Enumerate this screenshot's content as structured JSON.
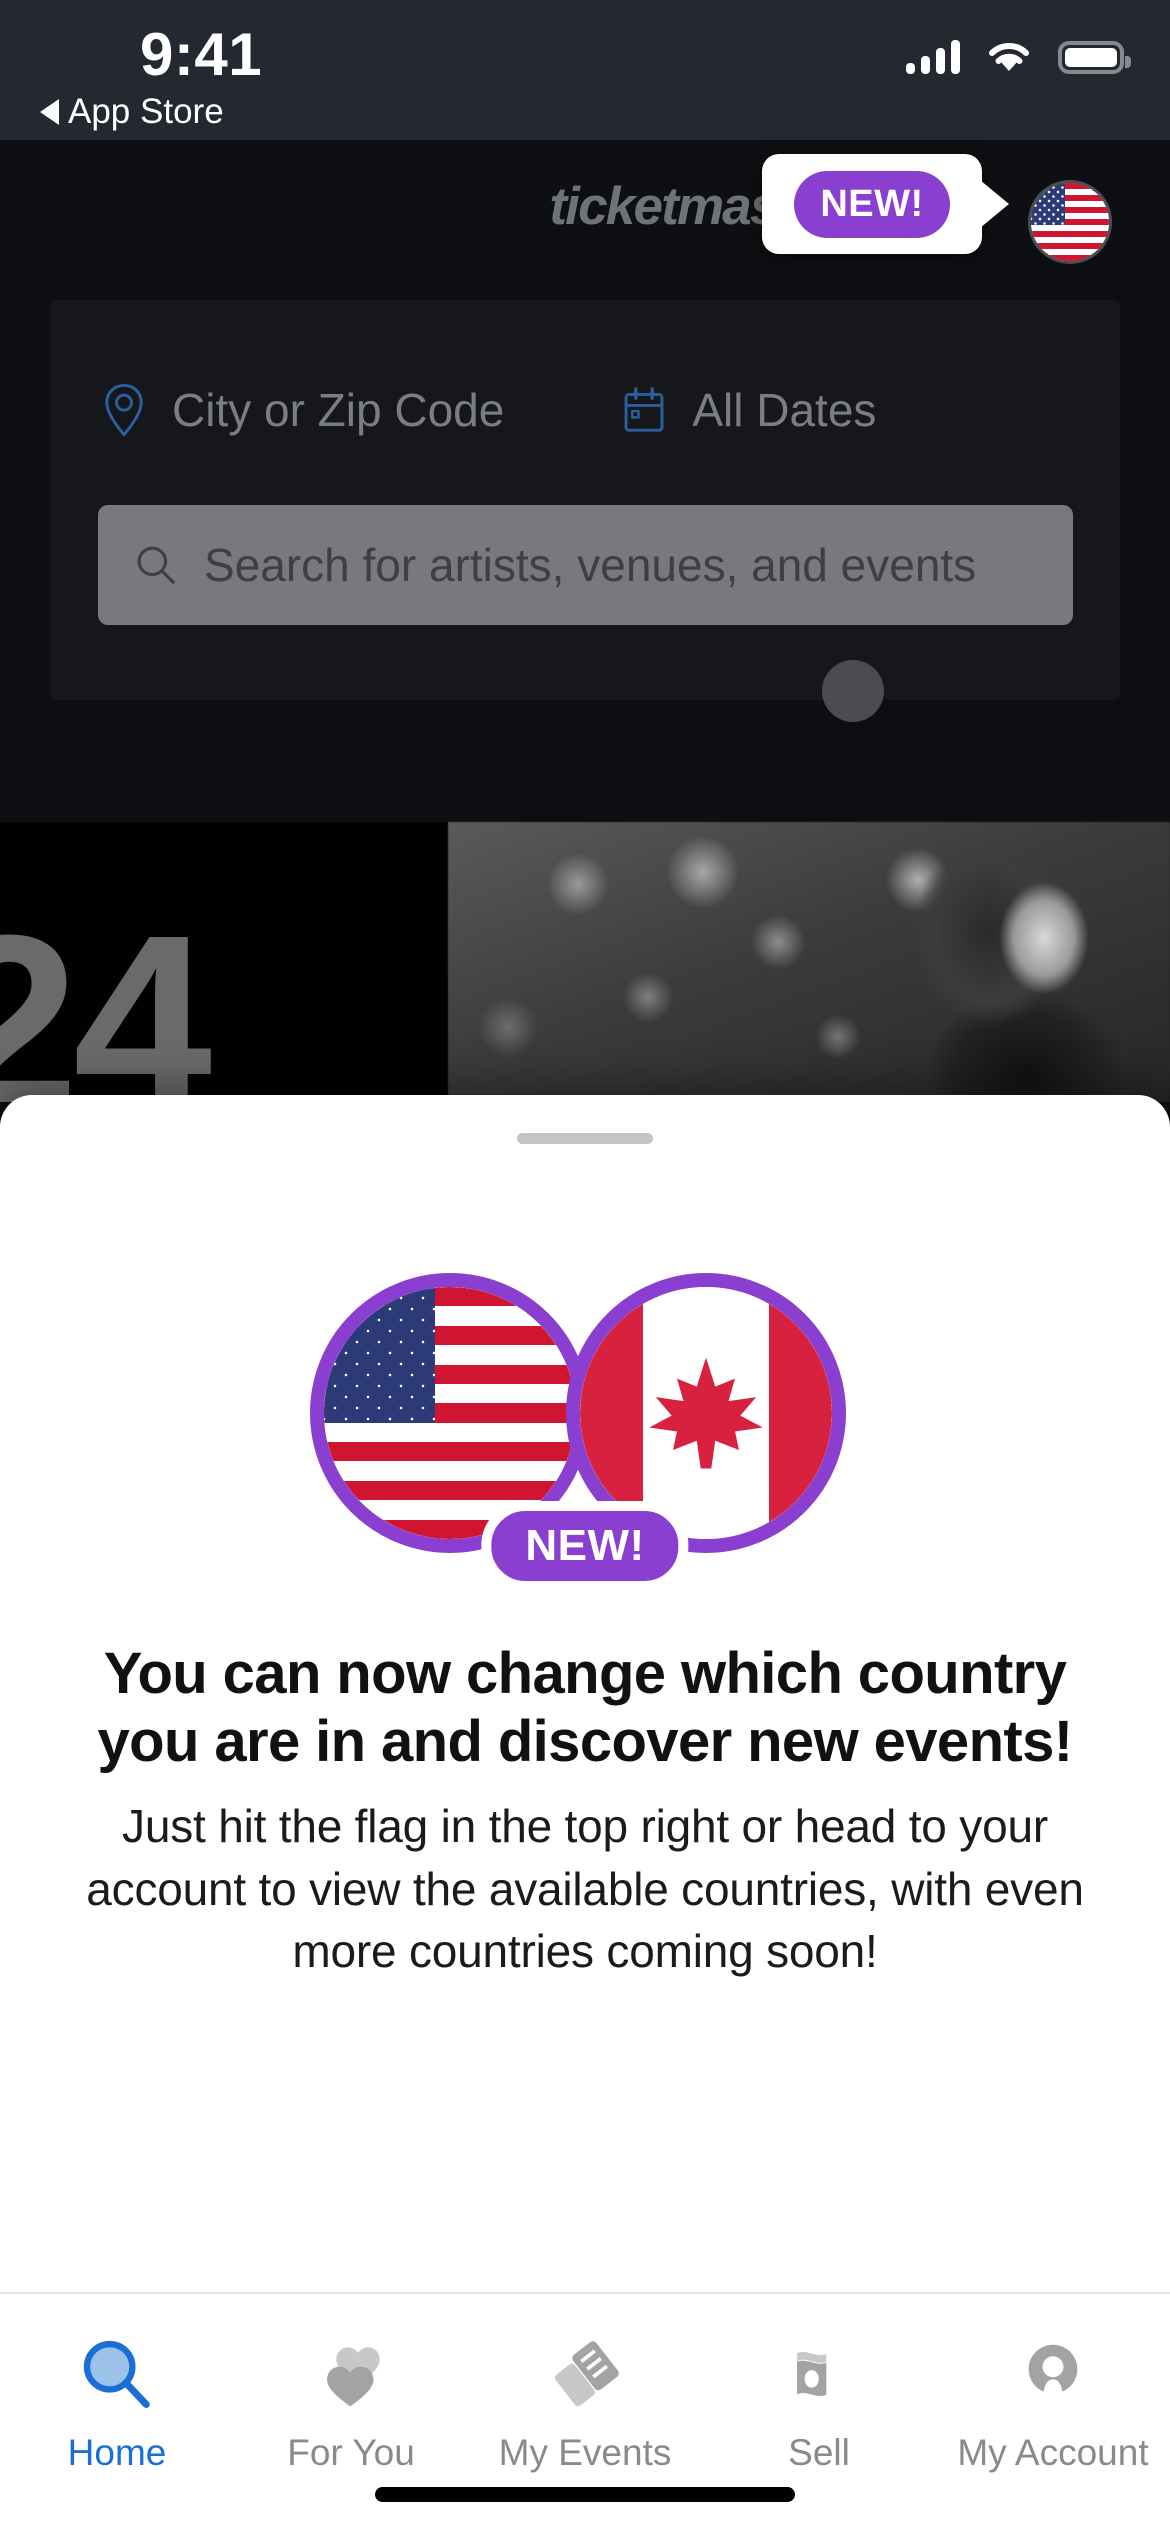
{
  "status_bar": {
    "time": "9:41",
    "back_label": "App Store",
    "signal_icon": "cellular-signal-icon",
    "wifi_icon": "wifi-icon",
    "battery_icon": "battery-icon"
  },
  "header": {
    "logo_text": "ticketmaster",
    "tooltip_badge": "NEW!",
    "country_flag_icon": "us-flag-icon"
  },
  "search_panel": {
    "location_placeholder": "City or Zip Code",
    "location_icon": "map-pin-icon",
    "date_value": "All Dates",
    "date_icon": "calendar-icon",
    "search_placeholder": "Search for artists, venues, and events",
    "search_icon": "search-icon"
  },
  "hero": {
    "left_text": "24",
    "image_alt": "concert-singer-photo"
  },
  "sheet": {
    "grabber": "drag-handle",
    "illustration": {
      "us_flag_icon": "us-flag-circle-icon",
      "canada_flag_icon": "canada-flag-circle-icon",
      "badge": "NEW!"
    },
    "title": "You can now change which country you are in and discover new events!",
    "body": "Just hit the flag in the top right or head to your account to view the available countries, with even more countries coming soon!"
  },
  "tabbar": {
    "items": [
      {
        "label": "Home",
        "icon": "search-icon",
        "active": true
      },
      {
        "label": "For You",
        "icon": "heart-icon",
        "active": false
      },
      {
        "label": "My Events",
        "icon": "tickets-icon",
        "active": false
      },
      {
        "label": "Sell",
        "icon": "ticket-stub-icon",
        "active": false
      },
      {
        "label": "My Account",
        "icon": "person-icon",
        "active": false
      }
    ]
  },
  "colors": {
    "brand_purple": "#8b3fd0",
    "accent_blue": "#1a6fd4",
    "flag_red": "#cf1530",
    "canada_red": "#d8213f",
    "status_bar_bg": "#242831",
    "sheet_bg": "#ffffff"
  }
}
